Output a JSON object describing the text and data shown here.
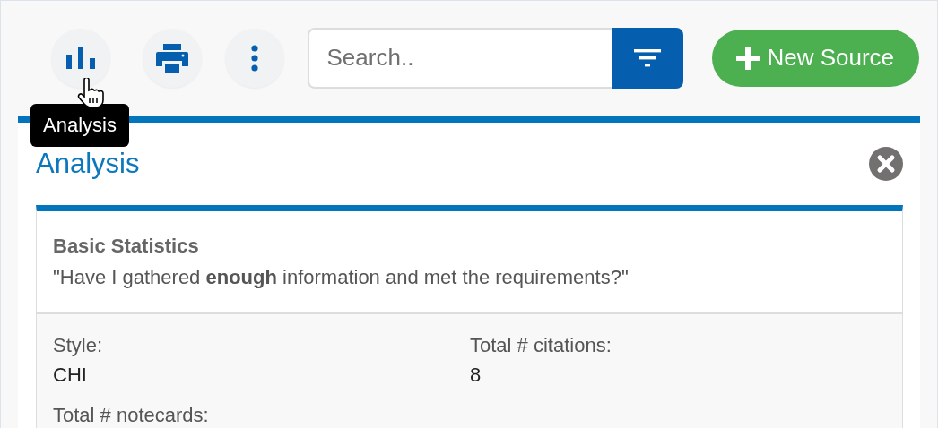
{
  "toolbar": {
    "buttons": [
      {
        "kind": "chart",
        "tooltip": "Analysis"
      },
      {
        "kind": "print"
      },
      {
        "kind": "more"
      }
    ],
    "search": {
      "placeholder": "Search.."
    },
    "new_button": {
      "label": "New Source"
    }
  },
  "panel": {
    "title": "Analysis",
    "card": {
      "title": "Basic Statistics",
      "subtitle": "\"Have I gathered **enough** information and met the requirements?\"",
      "stats": [
        {
          "label": "Style:",
          "value": "CHI"
        },
        {
          "label": "Total # citations:",
          "value": "8"
        },
        {
          "label": "Total # notecards:"
        }
      ]
    }
  }
}
